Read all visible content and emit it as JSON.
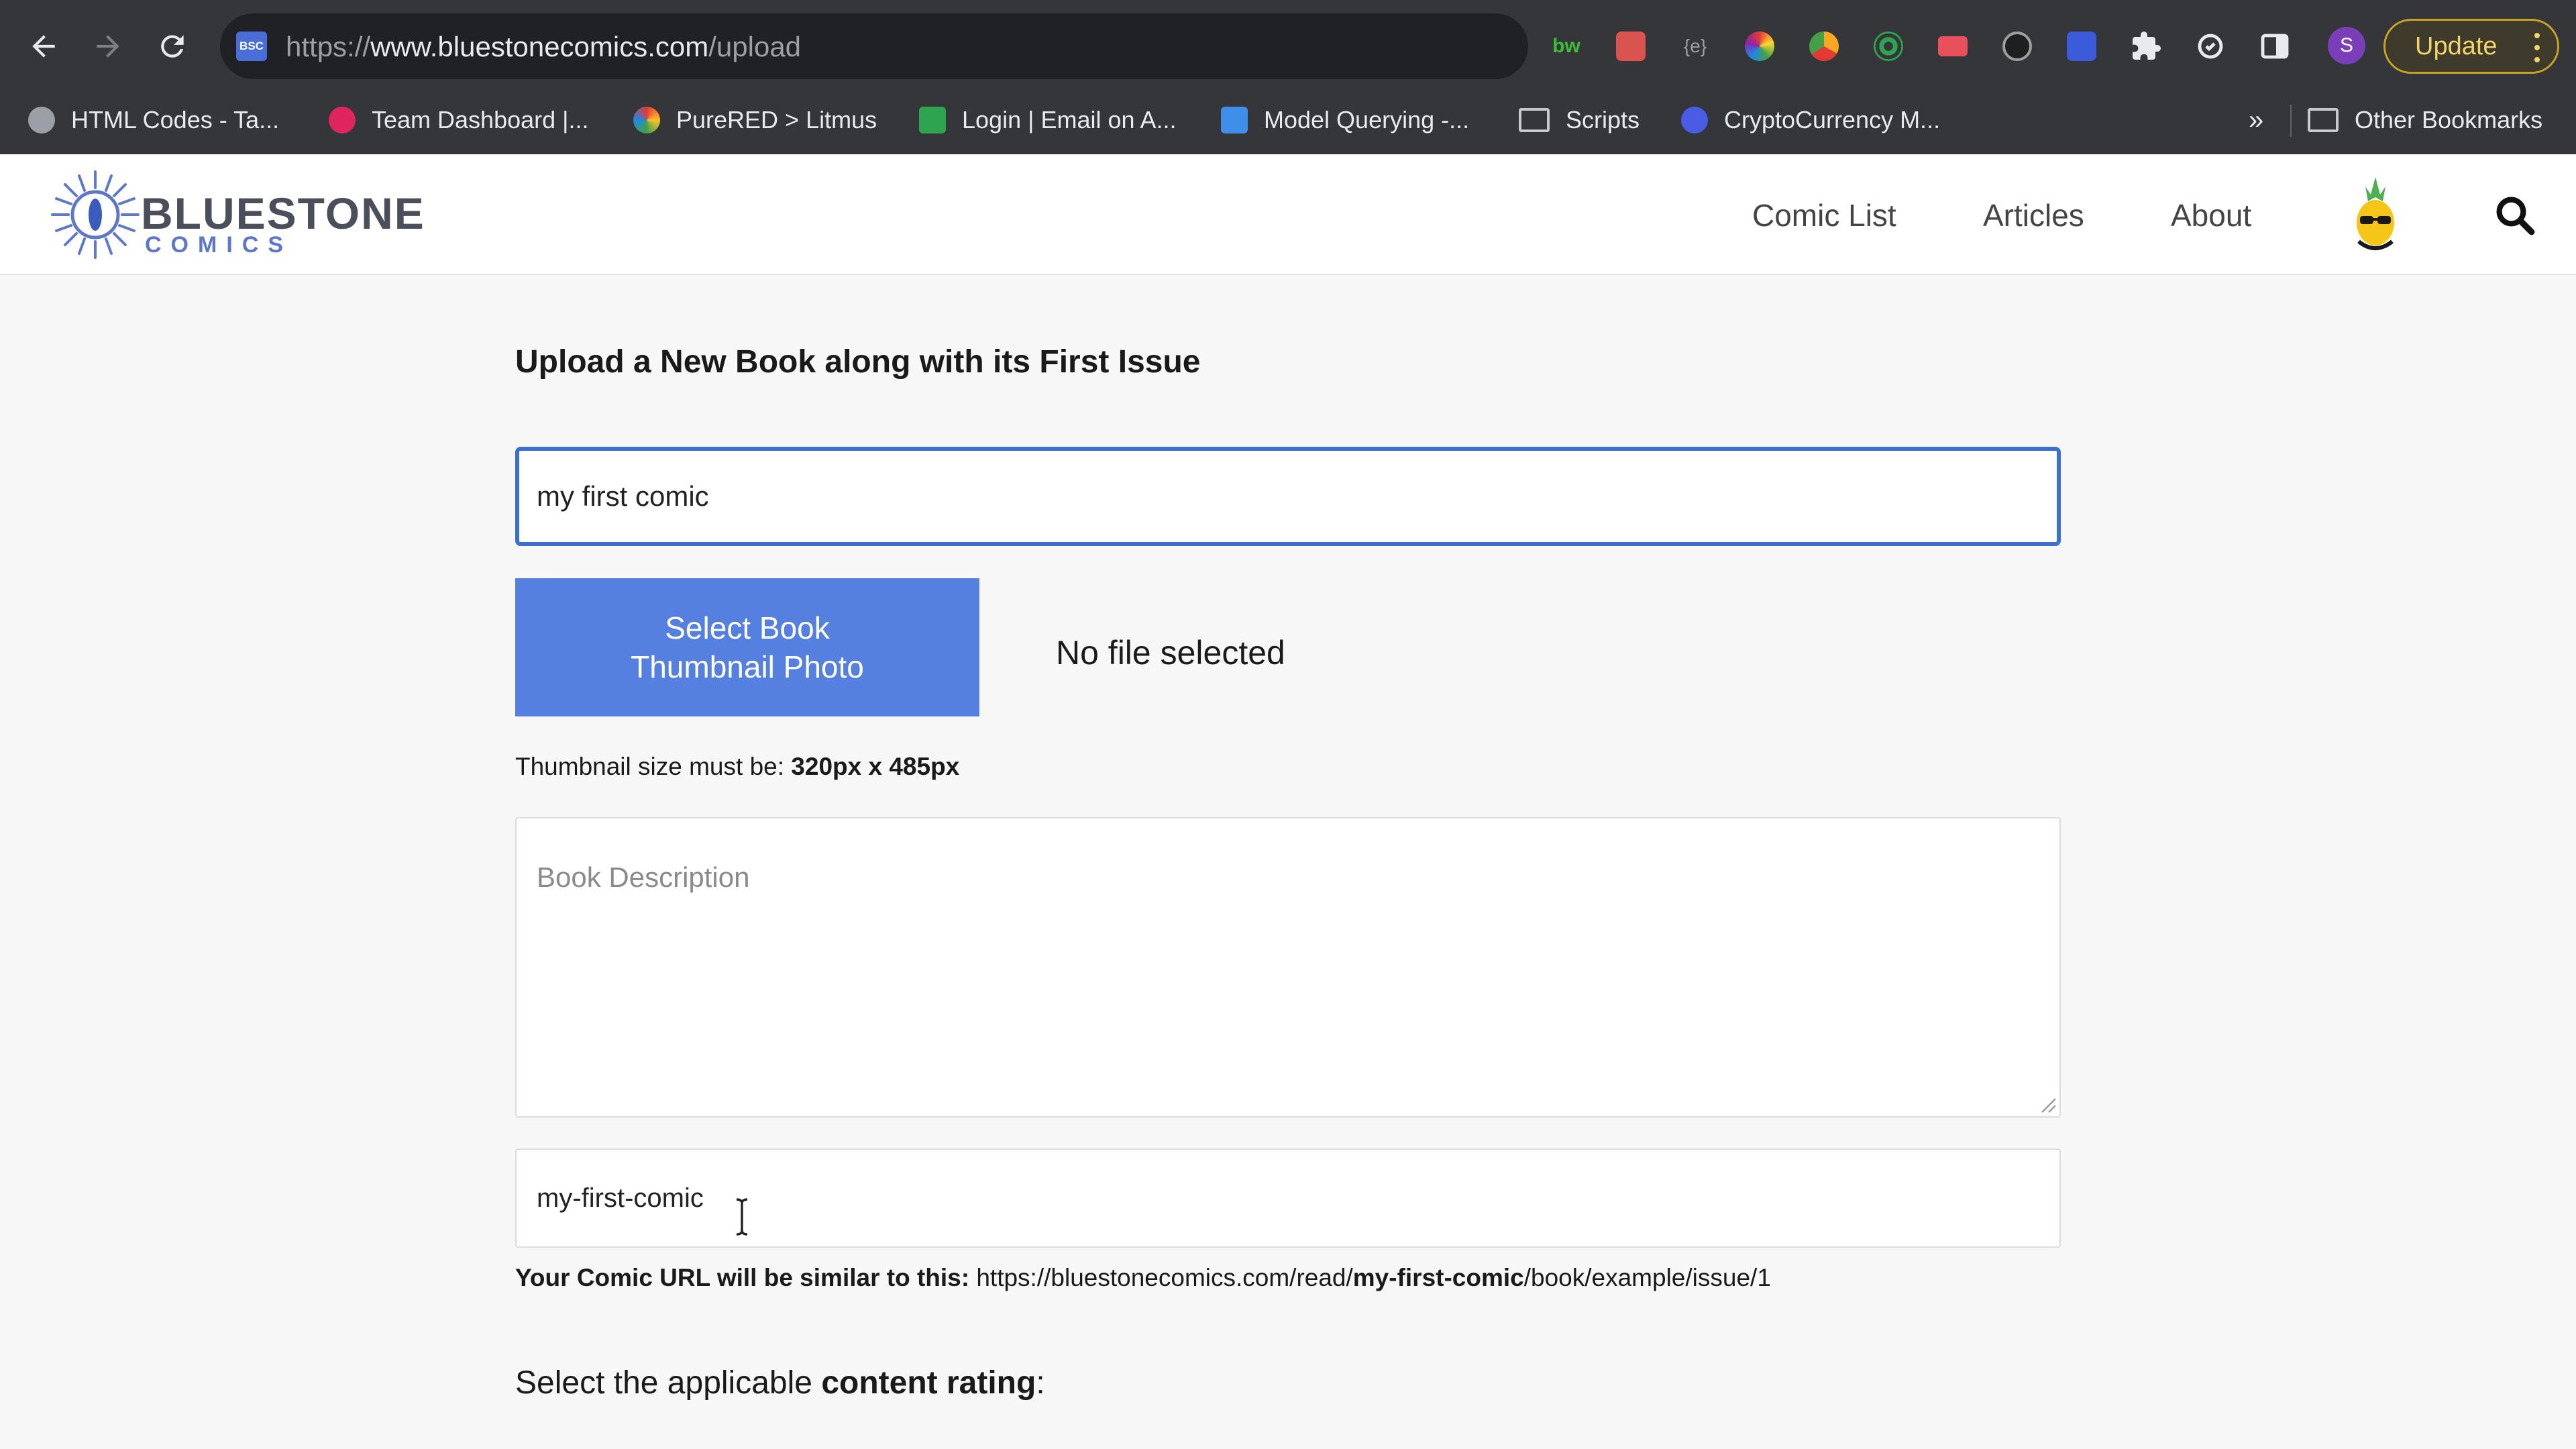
{
  "browser": {
    "url_scheme": "https://",
    "url_host": "www.bluestonecomics.com",
    "url_path": "/upload",
    "site_icon_text": "BSC",
    "profile_initial": "S",
    "update_label": "Update",
    "bookmarks": [
      {
        "label": "HTML Codes - Ta...",
        "icon": "globe-icon"
      },
      {
        "label": "Team Dashboard |...",
        "icon": "team-dashboard-icon"
      },
      {
        "label": "PureRED > Litmus",
        "icon": "litmus-icon"
      },
      {
        "label": "Login | Email on A...",
        "icon": "email-on-acid-icon"
      },
      {
        "label": "Model Querying -...",
        "icon": "cube-icon"
      },
      {
        "label": "Scripts",
        "icon": "folder-icon"
      },
      {
        "label": "CryptoCurrency M...",
        "icon": "crypto-icon"
      }
    ],
    "bookmarks_more": "»",
    "other_bookmarks": "Other Bookmarks",
    "extension_icons": [
      "bw-extension-icon",
      "gift-extension-icon",
      "code-extension-icon",
      "color-wheel-icon",
      "chrome-dev-icon",
      "target-icon",
      "video-record-icon",
      "badge-extension-icon",
      "activity-extension-icon",
      "puzzle-icon",
      "sync-icon",
      "sidebar-icon"
    ]
  },
  "site": {
    "logo_word": "BLUESTONE",
    "logo_sub": "COMICS",
    "nav": [
      "Comic List",
      "Articles",
      "About"
    ],
    "brand_color": "#5580e0"
  },
  "form": {
    "title": "Upload a New Book along with its First Issue",
    "book_title_value": "my first comic",
    "thumb_button_label": "Select Book Thumbnail Photo",
    "file_status": "No file selected",
    "thumb_note_prefix": "Thumbnail size must be: ",
    "thumb_note_size": "320px x 485px",
    "description_placeholder": "Book Description",
    "slug_value": "my-first-comic",
    "url_preview_label": "Your Comic URL will be similar to this:",
    "url_preview_base": " https://bluestonecomics.com/read/",
    "url_preview_slug": "my-first-comic",
    "url_preview_tail": "/book/example/issue/1",
    "rating_prefix": "Select the applicable ",
    "rating_bold": "content rating",
    "rating_suffix": ":"
  }
}
